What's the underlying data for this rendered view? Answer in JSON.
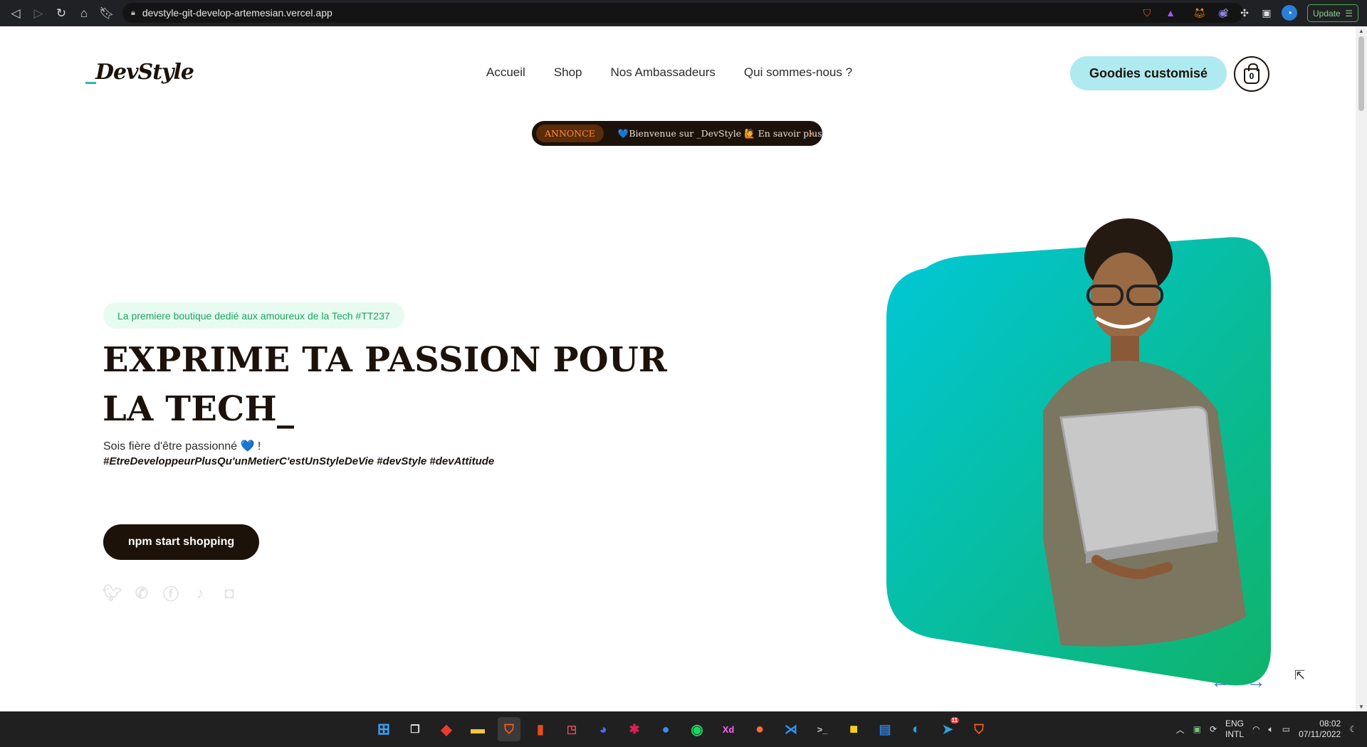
{
  "browser": {
    "url": "devstyle-git-develop-artemesian.vercel.app",
    "update_label": "Update"
  },
  "site": {
    "logo_prefix": "_",
    "logo_text": "DevStyle",
    "menu": [
      {
        "label": "Accueil"
      },
      {
        "label": "Shop"
      },
      {
        "label": "Nos Ambassadeurs"
      },
      {
        "label": "Qui sommes-nous ?"
      }
    ],
    "goodies_label": "Goodies customisé",
    "cart_count": "0",
    "announcement": {
      "tag": "ANNONCE",
      "text": "💙Bienvenue sur _DevStyle 🙋 En savoir plus"
    },
    "hero": {
      "badge": "La premiere boutique dedié aux amoureux de la Tech #TT237",
      "title": "EXPRIME TA PASSION POUR LA TECH_",
      "subtitle": "Sois fière d'être passionné 💙 !",
      "hashtags": "#EtreDeveloppeurPlusQu'unMetierC'estUnStyleDeVie #devStyle #devAttitude",
      "cta_label": "npm start shopping"
    },
    "socials": [
      "twitter-icon",
      "whatsapp-icon",
      "facebook-icon",
      "tiktok-icon",
      "instagram-icon"
    ],
    "accent_colors": {
      "dark": "#1c1209",
      "cyan": "#aeeaf0",
      "gradient_start": "#00c8d8",
      "gradient_end": "#0fb36a"
    }
  },
  "taskbar": {
    "language": "ENG",
    "layout": "INTL",
    "time": "08:02",
    "date": "07/11/2022",
    "telegram_badge": "11"
  }
}
